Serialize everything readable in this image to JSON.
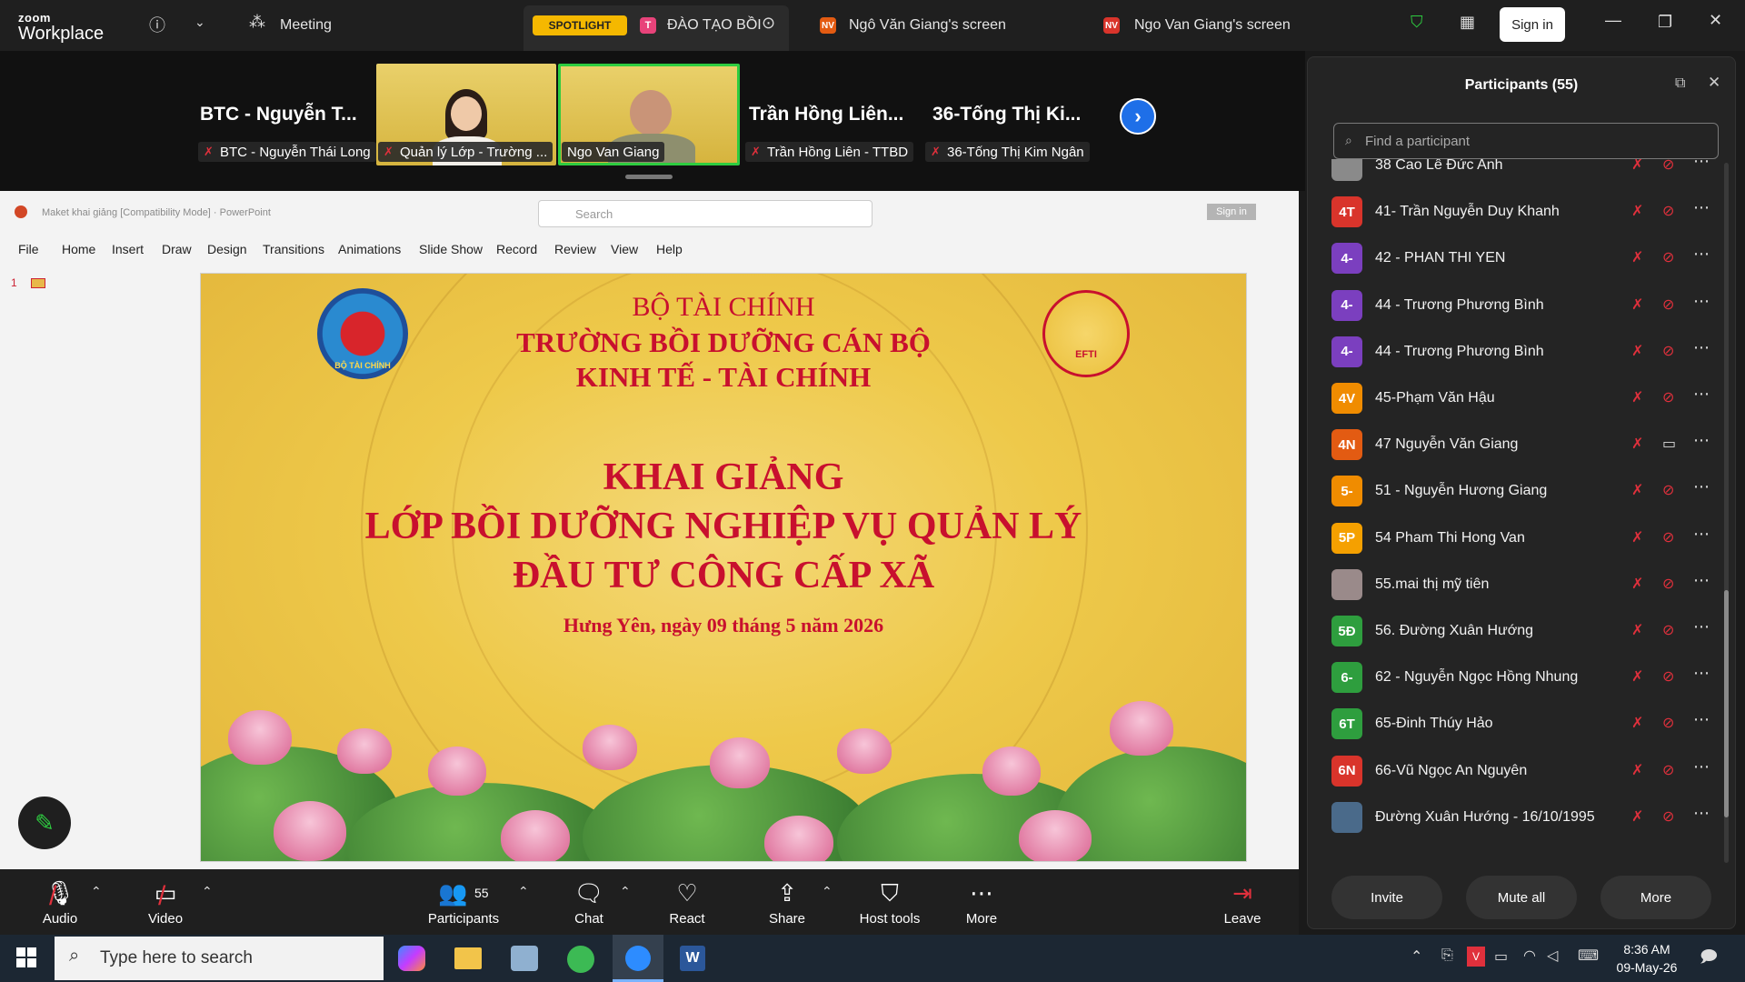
{
  "topbar": {
    "brand_small": "zoom",
    "brand_big": "Workplace",
    "meeting_label": "Meeting",
    "spotlight_badge": "SPOTLIGHT",
    "tab_avatar": "T",
    "tab_title": "ĐÀO TẠO BỒI",
    "screen1_avatar": "NV",
    "screen1_label": "Ngô Văn Giang's screen",
    "screen2_avatar": "NV",
    "screen2_label": "Ngo Van Giang's screen",
    "sign_in": "Sign in"
  },
  "gallery": {
    "tile1_name": "BTC - Nguyễn T...",
    "tile1_label": "BTC - Nguyễn Thái Long",
    "tile2_label": "Quản lý Lớp - Trường ...",
    "tile3_label": "Ngo Van Giang",
    "tile4_name": "Trần Hồng Liên...",
    "tile4_label": "Trần Hồng Liên - TTBD",
    "tile5_name": "36-Tống Thị Ki...",
    "tile5_label": "36-Tống Thị Kim Ngân"
  },
  "ppt": {
    "filename": "Maket khai giảng [Compatibility Mode]",
    "app": "PowerPoint",
    "search_placeholder": "Search",
    "sign_in": "Sign in",
    "menu": [
      "File",
      "Home",
      "Insert",
      "Draw",
      "Design",
      "Transitions",
      "Animations",
      "Slide Show",
      "Record",
      "Review",
      "View",
      "Help"
    ],
    "slide_number": "1",
    "slide": {
      "line1": "BỘ TÀI CHÍNH",
      "line2": "TRƯỜNG BỒI DƯỠNG CÁN BỘ",
      "line3": "KINH TẾ - TÀI CHÍNH",
      "line4": "KHAI GIẢNG",
      "line5": "LỚP BỒI DƯỠNG NGHIỆP VỤ QUẢN LÝ",
      "line6": "ĐẦU TƯ CÔNG CẤP XÃ",
      "line7": "Hưng Yên, ngày 09 tháng 5 năm 2026",
      "logo_left_text": "BỘ TÀI CHÍNH",
      "logo_right_text": "EFTI"
    }
  },
  "toolbar": {
    "audio": "Audio",
    "video": "Video",
    "participants_count": "55",
    "participants": "Participants",
    "chat": "Chat",
    "react": "React",
    "share": "Share",
    "host_tools": "Host tools",
    "more": "More",
    "leave": "Leave"
  },
  "panel": {
    "title": "Participants (55)",
    "search_placeholder": "Find a participant",
    "participants": [
      {
        "avatar": "",
        "name": "38 Cao Lê Đức Anh",
        "color": "#8a8a8a"
      },
      {
        "avatar": "4T",
        "name": "41- Trần Nguyễn Duy Khanh",
        "color": "#d9342b"
      },
      {
        "avatar": "4-",
        "name": "42 - PHAN THI YEN",
        "color": "#7b3fbf"
      },
      {
        "avatar": "4-",
        "name": "44 - Trương Phương Bình",
        "color": "#7b3fbf"
      },
      {
        "avatar": "4-",
        "name": "44 - Trương Phương Bình",
        "color": "#7b3fbf"
      },
      {
        "avatar": "4V",
        "name": "45-Phạm Văn Hậu",
        "color": "#f08c00"
      },
      {
        "avatar": "4N",
        "name": "47 Nguyễn Văn Giang",
        "color": "#e35b12"
      },
      {
        "avatar": "5-",
        "name": "51 - Nguyễn Hương Giang",
        "color": "#f08c00"
      },
      {
        "avatar": "5P",
        "name": "54 Pham Thi Hong Van",
        "color": "#f5a000"
      },
      {
        "avatar": "",
        "name": "55.mai thị mỹ tiên",
        "color": "#9a8a8a"
      },
      {
        "avatar": "5Đ",
        "name": "56. Đường Xuân Hướng",
        "color": "#2e9e3e"
      },
      {
        "avatar": "6-",
        "name": "62 - Nguyễn Ngọc Hồng Nhung",
        "color": "#2e9e3e"
      },
      {
        "avatar": "6T",
        "name": "65-Đinh Thúy Hảo",
        "color": "#2e9e3e"
      },
      {
        "avatar": "6N",
        "name": "66-Vũ Ngọc An Nguyên",
        "color": "#d9342b"
      },
      {
        "avatar": "",
        "name": "Đường Xuân Hướng - 16/10/1995",
        "color": "#4a6a8a"
      }
    ],
    "invite": "Invite",
    "mute_all": "Mute all",
    "more": "More"
  },
  "taskbar": {
    "search_placeholder": "Type here to search",
    "time": "8:36 AM",
    "date": "09-May-26"
  }
}
